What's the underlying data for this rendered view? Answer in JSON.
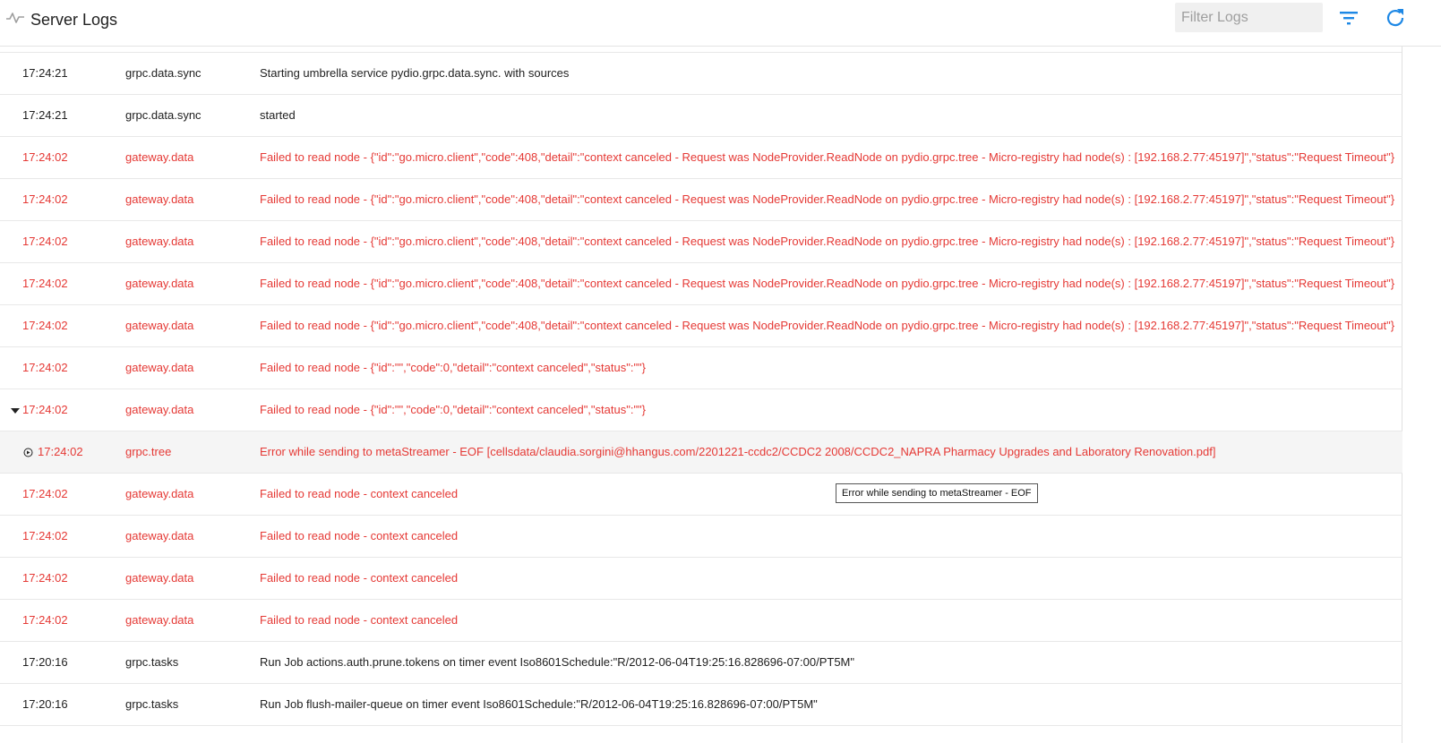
{
  "header": {
    "icon": "pulse-icon",
    "title": "Server Logs",
    "filter_placeholder": "Filter Logs",
    "filter_value": "",
    "filter_icon": "filter-list-icon",
    "refresh_icon": "refresh-icon"
  },
  "colors": {
    "error": "#e53935",
    "info": "#212121",
    "accent": "#1e88e5"
  },
  "rows": [
    {
      "level": "info",
      "time": "17:24:21",
      "service": "grpc.data.sync",
      "message": "Starting umbrella service pydio.grpc.data.sync. with sources"
    },
    {
      "level": "info",
      "time": "17:24:21",
      "service": "grpc.data.sync",
      "message": "started"
    },
    {
      "level": "error",
      "time": "17:24:02",
      "service": "gateway.data",
      "message": "Failed to read node - {\"id\":\"go.micro.client\",\"code\":408,\"detail\":\"context canceled - Request was NodeProvider.ReadNode on pydio.grpc.tree - Micro-registry had node(s) : [192.168.2.77:45197]\",\"status\":\"Request Timeout\"}"
    },
    {
      "level": "error",
      "time": "17:24:02",
      "service": "gateway.data",
      "message": "Failed to read node - {\"id\":\"go.micro.client\",\"code\":408,\"detail\":\"context canceled - Request was NodeProvider.ReadNode on pydio.grpc.tree - Micro-registry had node(s) : [192.168.2.77:45197]\",\"status\":\"Request Timeout\"}"
    },
    {
      "level": "error",
      "time": "17:24:02",
      "service": "gateway.data",
      "message": "Failed to read node - {\"id\":\"go.micro.client\",\"code\":408,\"detail\":\"context canceled - Request was NodeProvider.ReadNode on pydio.grpc.tree - Micro-registry had node(s) : [192.168.2.77:45197]\",\"status\":\"Request Timeout\"}"
    },
    {
      "level": "error",
      "time": "17:24:02",
      "service": "gateway.data",
      "message": "Failed to read node - {\"id\":\"go.micro.client\",\"code\":408,\"detail\":\"context canceled - Request was NodeProvider.ReadNode on pydio.grpc.tree - Micro-registry had node(s) : [192.168.2.77:45197]\",\"status\":\"Request Timeout\"}"
    },
    {
      "level": "error",
      "time": "17:24:02",
      "service": "gateway.data",
      "message": "Failed to read node - {\"id\":\"go.micro.client\",\"code\":408,\"detail\":\"context canceled - Request was NodeProvider.ReadNode on pydio.grpc.tree - Micro-registry had node(s) : [192.168.2.77:45197]\",\"status\":\"Request Timeout\"}"
    },
    {
      "level": "error",
      "time": "17:24:02",
      "service": "gateway.data",
      "message": "Failed to read node - {\"id\":\"\",\"code\":0,\"detail\":\"context canceled\",\"status\":\"\"}"
    },
    {
      "level": "error",
      "time": "17:24:02",
      "service": "gateway.data",
      "message": "Failed to read node - {\"id\":\"\",\"code\":0,\"detail\":\"context canceled\",\"status\":\"\"}",
      "expanded": true
    },
    {
      "level": "error",
      "time": "17:24:02",
      "service": "grpc.tree",
      "message": "Error while sending to metaStreamer - EOF [cellsdata/claudia.sorgini@hhangus.com/2201221-ccdc2/CCDC2 2008/CCDC2_NAPRA Pharmacy Upgrades and Laboratory Renovation.pdf]",
      "child": true
    },
    {
      "level": "error",
      "time": "17:24:02",
      "service": "gateway.data",
      "message": "Failed to read node - context canceled"
    },
    {
      "level": "error",
      "time": "17:24:02",
      "service": "gateway.data",
      "message": "Failed to read node - context canceled"
    },
    {
      "level": "error",
      "time": "17:24:02",
      "service": "gateway.data",
      "message": "Failed to read node - context canceled"
    },
    {
      "level": "error",
      "time": "17:24:02",
      "service": "gateway.data",
      "message": "Failed to read node - context canceled"
    },
    {
      "level": "info",
      "time": "17:20:16",
      "service": "grpc.tasks",
      "message": "Run Job actions.auth.prune.tokens on timer event Iso8601Schedule:\"R/2012-06-04T19:25:16.828696-07:00/PT5M\""
    },
    {
      "level": "info",
      "time": "17:20:16",
      "service": "grpc.tasks",
      "message": "Run Job flush-mailer-queue on timer event Iso8601Schedule:\"R/2012-06-04T19:25:16.828696-07:00/PT5M\""
    }
  ],
  "tooltip": {
    "text": "Error while sending to metaStreamer - EOF"
  }
}
